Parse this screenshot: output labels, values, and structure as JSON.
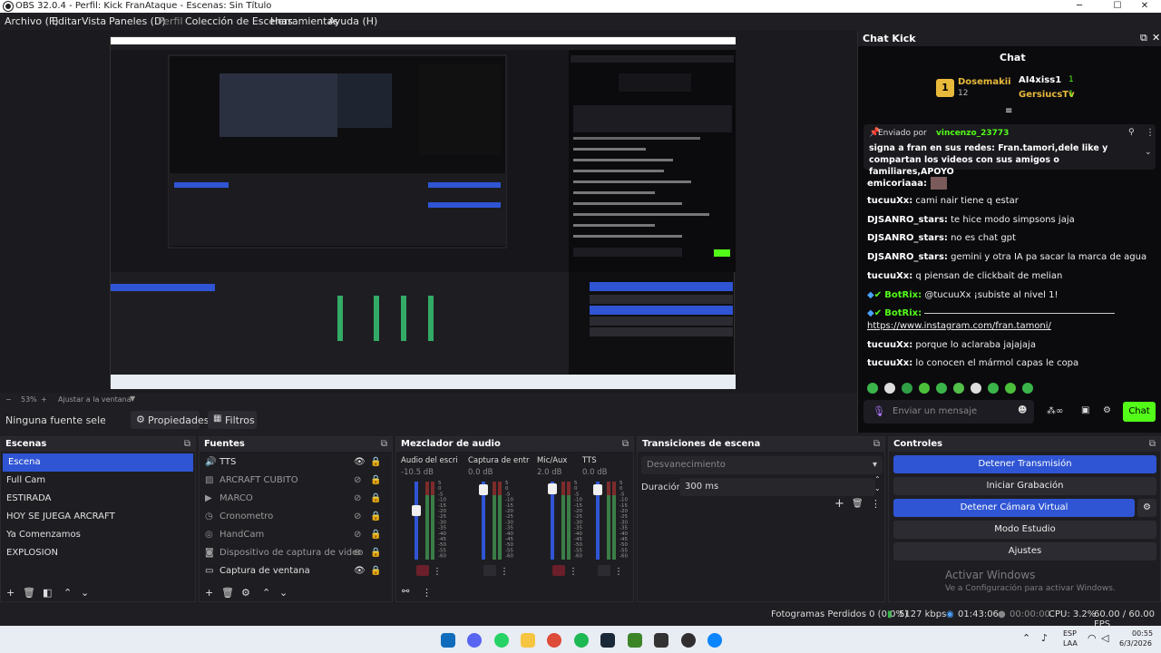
{
  "window": {
    "title": "OBS 32.0.4 - Perfil: Kick FranAtaque - Escenas: Sin Título",
    "min": "─",
    "max": "☐",
    "close": "✕"
  },
  "menu": [
    "Archivo (F)",
    "Editar",
    "Vista",
    "Paneles (D)",
    "Perfil",
    "Colección de Escenas",
    "Herramientas",
    "Ayuda (H)"
  ],
  "zoom": {
    "level": "53%",
    "fit_label": "Ajustar a la ventana"
  },
  "context_bar": {
    "no_source": "Ninguna fuente seleccionada",
    "properties": "Propiedades",
    "filters": "Filtros"
  },
  "chat": {
    "dock_title": "Chat Kick",
    "header": "Chat",
    "leaderboard": [
      {
        "rank": "1",
        "name": "Dosemakii",
        "count": "12"
      },
      {
        "name": "AI4xiss1",
        "count": "1"
      },
      {
        "name": "GersiucsTv",
        "count": "1"
      }
    ],
    "pinned_by_label": "Enviado por",
    "pinned_user": "vincenzo_23773",
    "pinned_text": "signa a fran en sus redes: Fran.tamori,dele like y compartan los videos con sus amigos o familiares,APOYO",
    "messages": [
      {
        "user": "emicoriaaa:",
        "text": ""
      },
      {
        "user": "tucuuXx:",
        "text": "cami nair tiene q estar"
      },
      {
        "user": "DJSANRO_stars:",
        "text": "te hice modo simpsons jaja"
      },
      {
        "user": "DJSANRO_stars:",
        "text": "no es chat gpt"
      },
      {
        "user": "DJSANRO_stars:",
        "text": "gemini y otra IA pa sacar la marca de agua"
      },
      {
        "user": "tucuuXx:",
        "text": "q piensan de clickbait de melian"
      },
      {
        "user": "BotRix:",
        "text": "@tucuuXx ¡subiste al nivel 1!"
      },
      {
        "user": "BotRix:",
        "text": "https://www.instagram.com/fran.tamoni/"
      },
      {
        "user": "tucuuXx:",
        "text": "porque lo aclaraba jajajaja"
      },
      {
        "user": "tucuuXx:",
        "text": "lo conocen el mármol capas le copa"
      }
    ],
    "input_placeholder": "Enviar un mensaje",
    "send_button": "Chat"
  },
  "scenes": {
    "title": "Escenas",
    "items": [
      "Escena",
      "Full Cam",
      "ESTIRADA",
      "HOY SE JUEGA ARCRAFT",
      "Ya Comenzamos",
      "EXPLOSION"
    ]
  },
  "sources": {
    "title": "Fuentes",
    "items": [
      "TTS",
      "ARCRAFT CUBITO",
      "MARCO",
      "Cronometro",
      "HandCam",
      "Dispositivo de captura de video",
      "Captura de ventana"
    ]
  },
  "mixer": {
    "title": "Mezclador de audio",
    "channels": [
      {
        "name": "Audio del escritorio",
        "db": "-10.5 dB"
      },
      {
        "name": "Captura de entrada",
        "db": "0.0 dB"
      },
      {
        "name": "Mic/Aux",
        "db": "2.0 dB"
      },
      {
        "name": "TTS",
        "db": "0.0 dB"
      }
    ],
    "scale": [
      "5",
      "0",
      "-5",
      "-10",
      "-15",
      "-20",
      "-25",
      "-30",
      "-35",
      "-40",
      "-45",
      "-50",
      "-55",
      "-60"
    ]
  },
  "transitions": {
    "title": "Transiciones de escena",
    "selected": "Desvanecimiento",
    "duration_label": "Duración",
    "duration_value": "300 ms"
  },
  "controls": {
    "title": "Controles",
    "stop_stream": "Detener Transmisión",
    "start_recording": "Iniciar Grabación",
    "stop_virtual_cam": "Detener Cámara Virtual",
    "studio_mode": "Modo Estudio",
    "settings": "Ajustes",
    "watermark_title": "Activar Windows",
    "watermark_sub": "Ve a Configuración para activar Windows."
  },
  "status": {
    "dropped": "Fotogramas Perdidos 0 (0.0%)",
    "bitrate": "5127 kbps",
    "stream_time": "01:43:06",
    "rec_time": "00:00:00",
    "cpu": "CPU: 3.2%",
    "fps": "60.00 / 60.00 FPS"
  },
  "taskbar": {
    "lang1": "ESP",
    "lang2": "LAA",
    "time": "00:55",
    "date": "6/3/2026"
  },
  "colors": {
    "accent": "#2f55d4",
    "kick_green": "#53fc18",
    "bg": "#1f1f23"
  }
}
